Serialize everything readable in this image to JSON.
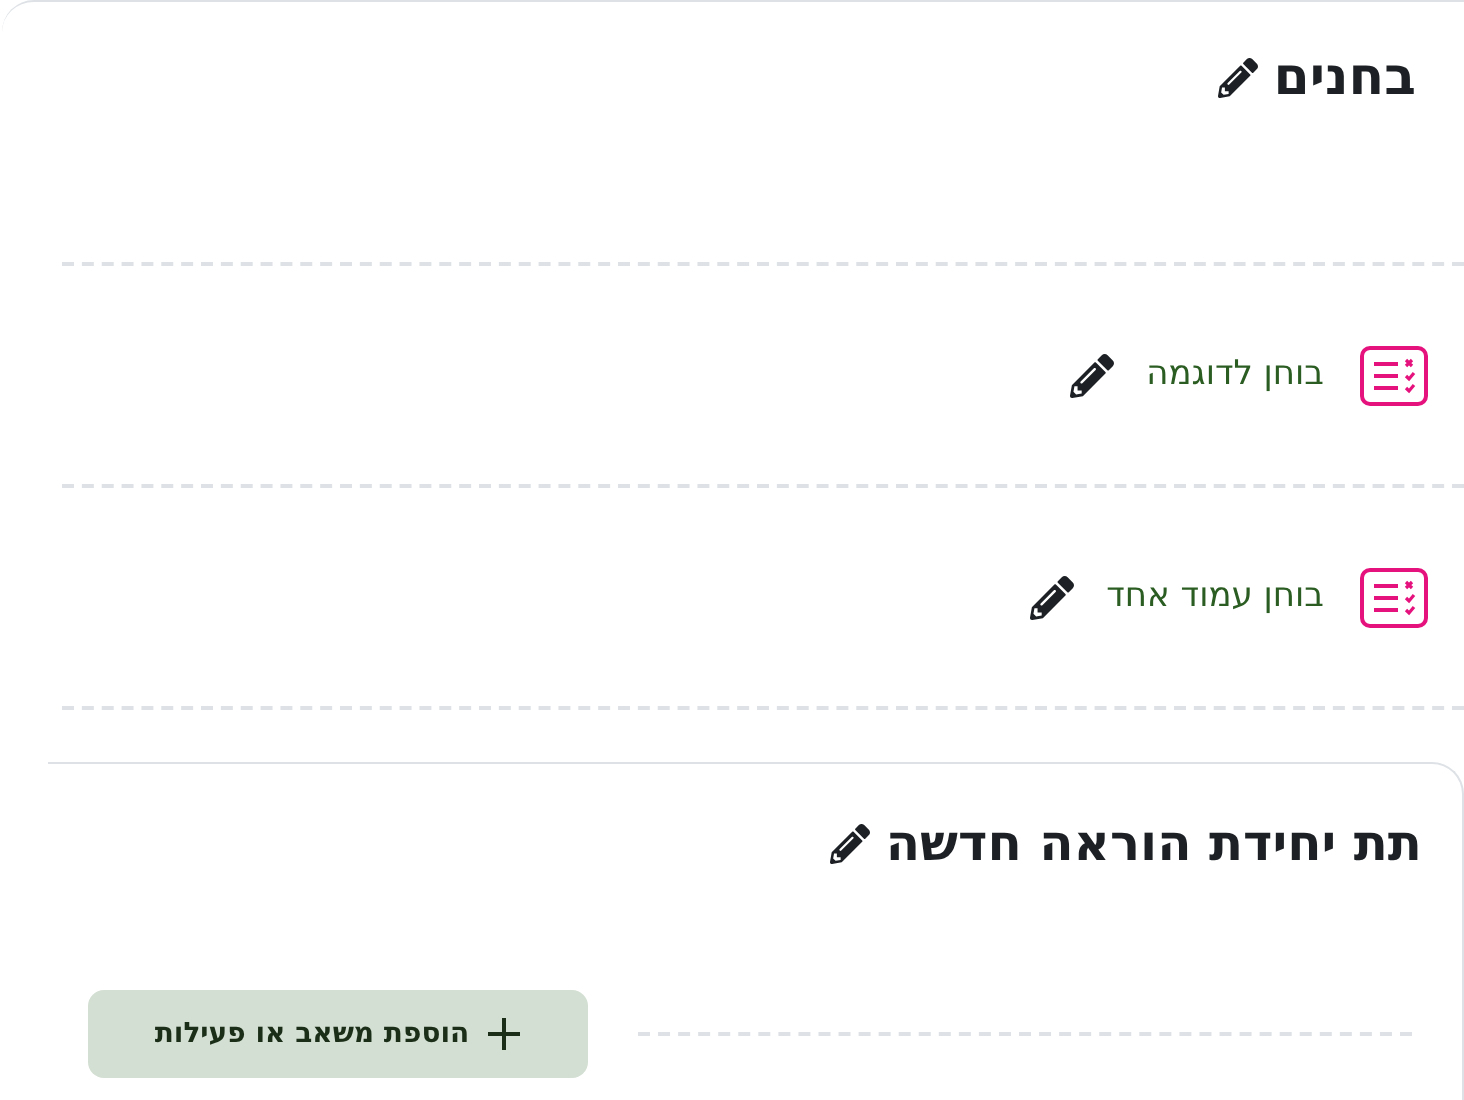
{
  "section": {
    "title": "בחנים"
  },
  "activities": [
    {
      "name": "בוחן לדוגמה"
    },
    {
      "name": "בוחן עמוד אחד"
    }
  ],
  "subsection": {
    "title": "תת יחידת הוראה חדשה",
    "add_button": "הוספת משאב או פעילות"
  }
}
